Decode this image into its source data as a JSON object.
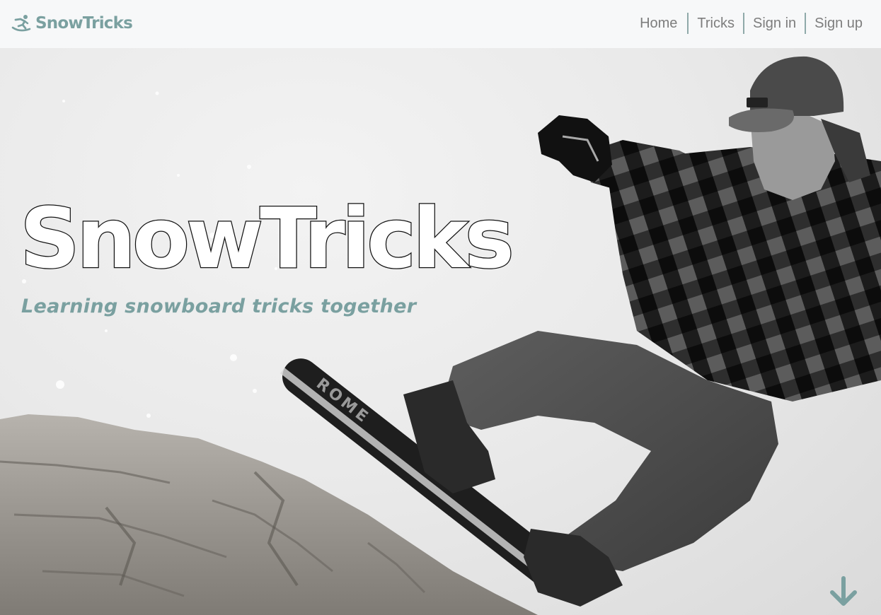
{
  "brand": {
    "name": "SnowTricks",
    "icon": "snowboarder-icon",
    "color": "#7aa0a0"
  },
  "nav": {
    "items": [
      {
        "label": "Home"
      },
      {
        "label": "Tricks"
      },
      {
        "label": "Sign in"
      },
      {
        "label": "Sign up"
      }
    ]
  },
  "hero": {
    "title": "SnowTricks",
    "tagline": "Learning snowboard tricks together",
    "scroll_icon": "arrow-down-icon",
    "accent": "#7aa0a0"
  }
}
